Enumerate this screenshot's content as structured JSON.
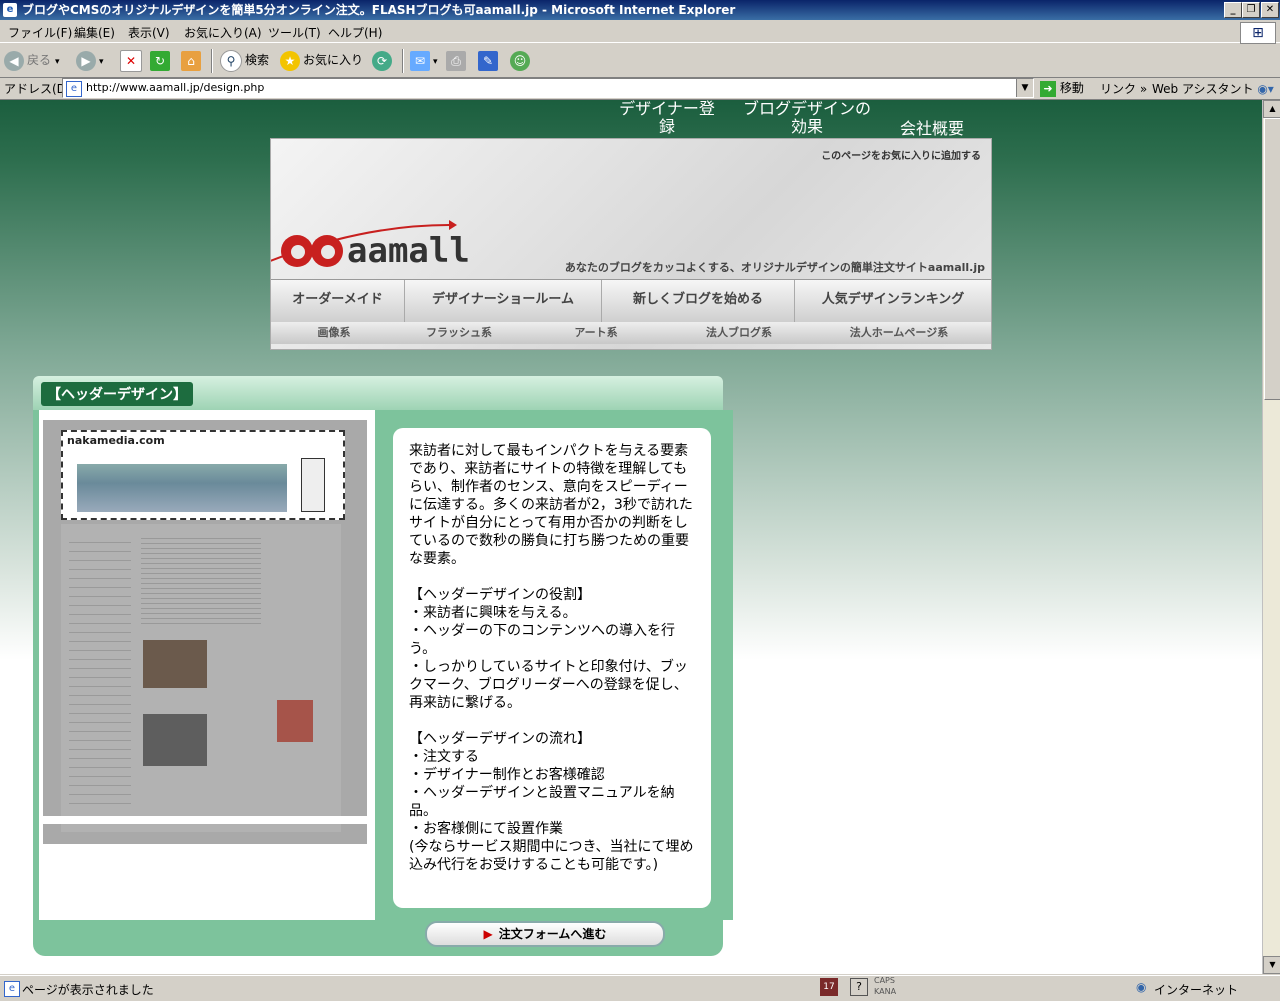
{
  "window": {
    "title": "ブログやCMSのオリジナルデザインを簡単5分オンライン注文。FLASHブログも可aamall.jp - Microsoft Internet Explorer",
    "minimize": "_",
    "restore": "❐",
    "close": "✕"
  },
  "menu": [
    "ファイル(F)",
    "編集(E)",
    "表示(V)",
    "お気に入り(A)",
    "ツール(T)",
    "ヘルプ(H)"
  ],
  "toolbar": {
    "back": "戻る",
    "search": "検索",
    "favorites": "お気に入り"
  },
  "address": {
    "label": "アドレス(D)",
    "url": "http://www.aamall.jp/design.php",
    "go": "移動",
    "links": "リンク",
    "assistant": "Web アシスタント"
  },
  "site": {
    "topnav": [
      "デザイナー登録",
      "ブログデザインの効果",
      "会社概要"
    ],
    "bookmark": "このページをお気に入りに追加する",
    "logo": "aamall",
    "tagline": "あなたのブログをカッコよくする、オリジナルデザインの簡単注文サイトaamall.jp",
    "nav": [
      "オーダーメイド",
      "デザイナーショールーム",
      "新しくブログを始める",
      "人気デザインランキング"
    ],
    "subnav": [
      "画像系",
      "フラッシュ系",
      "アート系",
      "法人ブログ系",
      "法人ホームページ系"
    ]
  },
  "panel": {
    "title": "【ヘッダーデザイン】",
    "example_site": "nakamedia.com",
    "description": "来訪者に対して最もインパクトを与える要素であり、来訪者にサイトの特徴を理解してもらい、制作者のセンス、意向をスピーディーに伝達する。多くの来訪者が2，3秒で訪れたサイトが自分にとって有用か否かの判断をしているので数秒の勝負に打ち勝つための重要な要素。\n\n【ヘッダーデザインの役割】\n・来訪者に興味を与える。\n・ヘッダーの下のコンテンツへの導入を行う。\n・しっかりしているサイトと印象付け、ブックマーク、ブログリーダーへの登録を促し、再来訪に繋げる。\n\n【ヘッダーデザインの流れ】\n・注文する\n・デザイナー制作とお客様確認\n・ヘッダーデザインと設置マニュアルを納品。\n・お客様側にて設置作業\n(今ならサービス期間中につき、当社にて埋め込み代行をお受けすることも可能です。)",
    "order_button": "注文フォームへ進む"
  },
  "status": {
    "text": "ページが表示されました",
    "caps": "CAPS",
    "kana": "KANA",
    "zone": "インターネット"
  }
}
